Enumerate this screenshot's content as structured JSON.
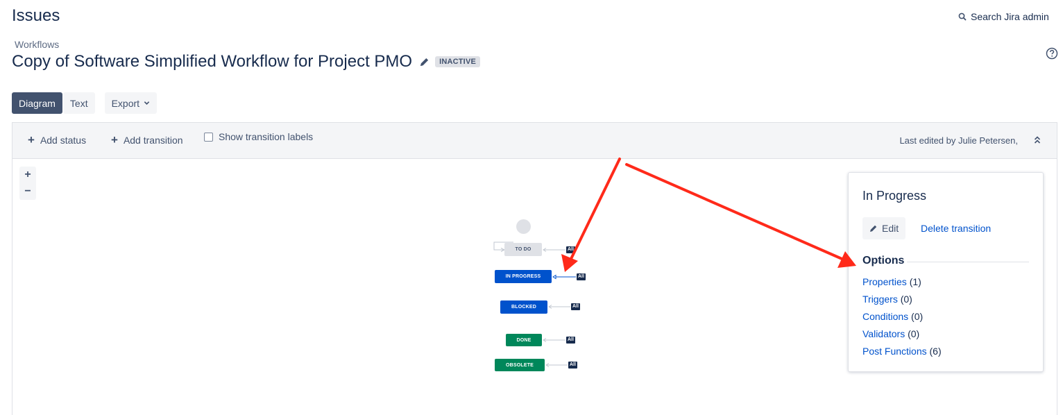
{
  "header": {
    "title": "Issues",
    "search_label": "Search Jira admin"
  },
  "breadcrumb": "Workflows",
  "workflow": {
    "title": "Copy of Software Simplified Workflow for Project PMO",
    "status_badge": "INACTIVE"
  },
  "view_tabs": {
    "diagram": "Diagram",
    "text": "Text",
    "export": "Export"
  },
  "toolbar": {
    "add_status": "Add status",
    "add_transition": "Add transition",
    "show_transition_labels": "Show transition labels",
    "show_transition_labels_checked": false,
    "last_edited": "Last edited by Julie Petersen,"
  },
  "zoom": {
    "zoom_in": "+",
    "zoom_out": "−"
  },
  "diagram": {
    "statuses": [
      {
        "label": "TO DO",
        "color": "#dfe1e6"
      },
      {
        "label": "IN PROGRESS",
        "color": "#0052cc"
      },
      {
        "label": "BLOCKED",
        "color": "#0052cc"
      },
      {
        "label": "DONE",
        "color": "#00875a"
      },
      {
        "label": "OBSOLETE",
        "color": "#00875a"
      }
    ],
    "global_transition_label": "All"
  },
  "panel": {
    "title": "In Progress",
    "edit_label": "Edit",
    "delete_label": "Delete transition",
    "options_heading": "Options",
    "options": [
      {
        "label": "Properties",
        "count": "(1)"
      },
      {
        "label": "Triggers",
        "count": "(0)"
      },
      {
        "label": "Conditions",
        "count": "(0)"
      },
      {
        "label": "Validators",
        "count": "(0)"
      },
      {
        "label": "Post Functions",
        "count": "(6)"
      }
    ]
  },
  "annotation": {
    "arrow_color": "#ff2a1a"
  }
}
